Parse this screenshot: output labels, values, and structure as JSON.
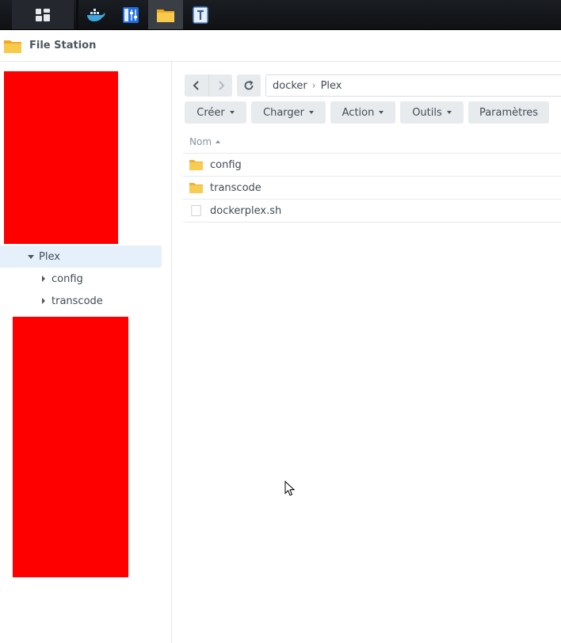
{
  "taskbar": {
    "apps": [
      {
        "icon": "main-menu-icon"
      },
      {
        "icon": "docker-icon"
      },
      {
        "icon": "control-panel-icon"
      },
      {
        "icon": "file-station-icon",
        "active": true
      },
      {
        "icon": "text-editor-icon"
      }
    ]
  },
  "window": {
    "title": "File Station",
    "icon": "file-station-folder-icon"
  },
  "tree": {
    "items": [
      {
        "label": "Plex",
        "expanded": true,
        "selected": true
      },
      {
        "label": "config",
        "expanded": false
      },
      {
        "label": "transcode",
        "expanded": false
      }
    ]
  },
  "path": {
    "segments": [
      "docker",
      "Plex"
    ],
    "separator": "›"
  },
  "toolbar": {
    "create_label": "Créer",
    "upload_label": "Charger",
    "action_label": "Action",
    "tools_label": "Outils",
    "settings_label": "Paramètres"
  },
  "list": {
    "column_name": "Nom",
    "sort": "ascending",
    "files": [
      {
        "name": "config",
        "type": "folder"
      },
      {
        "name": "transcode",
        "type": "folder"
      },
      {
        "name": "dockerplex.sh",
        "type": "file"
      }
    ]
  },
  "colors": {
    "accent_folder": "#f5c33b",
    "selected_row": "#e6f0fa",
    "redaction": "#ff0000"
  }
}
